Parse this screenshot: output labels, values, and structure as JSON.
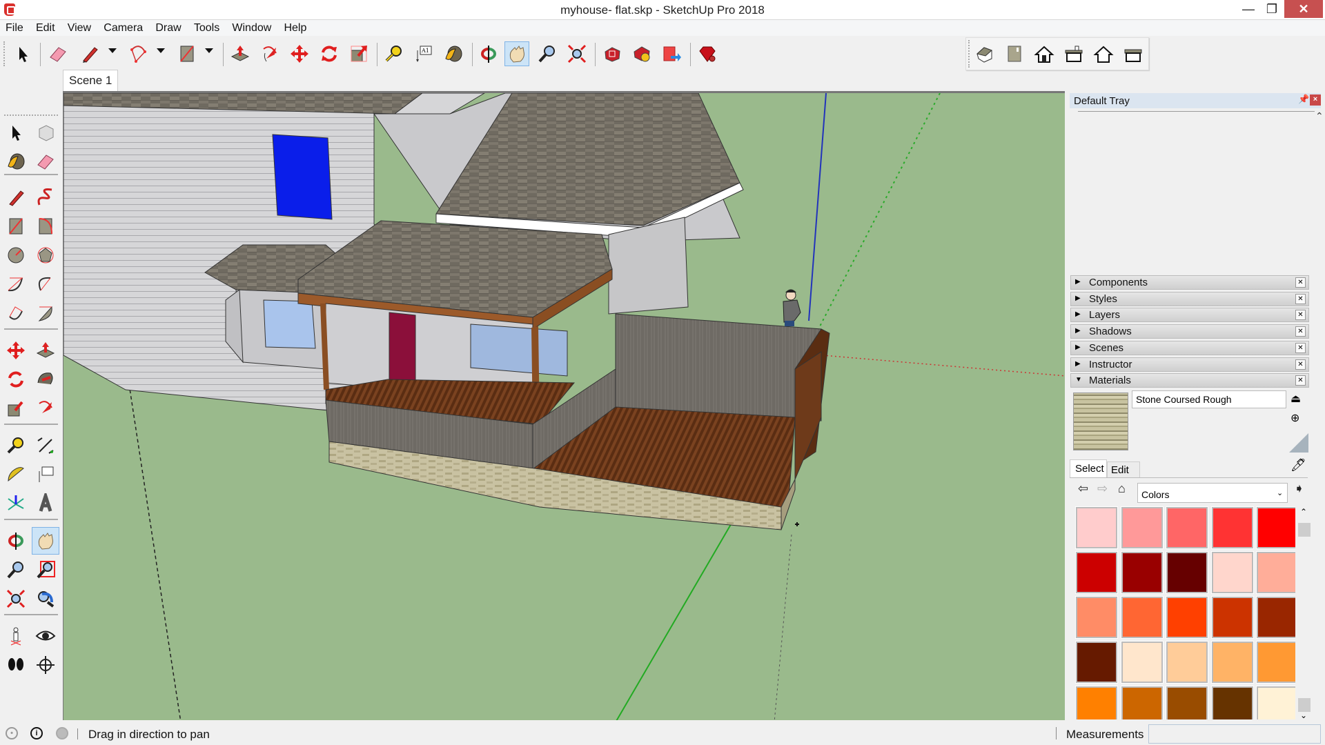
{
  "window": {
    "title": "myhouse- flat.skp - SketchUp Pro 2018",
    "controls": {
      "minimize": "—",
      "maximize": "❐",
      "close": "✕"
    }
  },
  "menu": [
    "File",
    "Edit",
    "View",
    "Camera",
    "Draw",
    "Tools",
    "Window",
    "Help"
  ],
  "toolbar": {
    "tools": [
      {
        "name": "select",
        "icon": "arrow-cursor-icon"
      },
      {
        "name": "eraser",
        "icon": "eraser-icon"
      },
      {
        "name": "line",
        "icon": "pencil-icon",
        "dropdown": true
      },
      {
        "name": "arc",
        "icon": "arc-icon",
        "dropdown": true
      },
      {
        "name": "rectangle",
        "icon": "rectangle-icon",
        "dropdown": true
      },
      {
        "name": "push-pull",
        "icon": "push-pull-icon"
      },
      {
        "name": "follow-me",
        "icon": "follow-me-icon"
      },
      {
        "name": "move",
        "icon": "move-icon"
      },
      {
        "name": "rotate",
        "icon": "rotate-icon"
      },
      {
        "name": "scale",
        "icon": "scale-icon"
      },
      {
        "name": "tape-measure",
        "icon": "tape-measure-icon"
      },
      {
        "name": "text",
        "icon": "text-label-icon"
      },
      {
        "name": "paint-bucket",
        "icon": "paint-bucket-icon"
      },
      {
        "name": "orbit",
        "icon": "orbit-icon"
      },
      {
        "name": "pan",
        "icon": "hand-icon",
        "active": true
      },
      {
        "name": "zoom",
        "icon": "magnifier-icon"
      },
      {
        "name": "zoom-extents",
        "icon": "zoom-extents-icon"
      },
      {
        "name": "3d-warehouse",
        "icon": "warehouse-icon"
      },
      {
        "name": "extension-warehouse",
        "icon": "extension-warehouse-icon"
      },
      {
        "name": "send-to-layout",
        "icon": "layout-send-icon"
      },
      {
        "name": "extension-manager",
        "icon": "ruby-gem-icon"
      }
    ],
    "views": [
      "iso-view-icon",
      "top-view-icon",
      "front-view-icon",
      "right-view-icon",
      "back-view-icon",
      "left-view-icon"
    ]
  },
  "scene_tab": "Scene 1",
  "left_toolbar": [
    [
      "select",
      "make-component"
    ],
    [
      "paint-bucket",
      "eraser"
    ],
    [
      "line",
      "freehand"
    ],
    [
      "rectangle",
      "rotated-rectangle"
    ],
    [
      "circle",
      "polygon"
    ],
    [
      "arc",
      "2-point-arc"
    ],
    [
      "3-point-arc",
      "pie"
    ],
    [
      "move",
      "push-pull"
    ],
    [
      "rotate",
      "follow-me"
    ],
    [
      "scale",
      "offset"
    ],
    [
      "tape-measure",
      "dimension"
    ],
    [
      "protractor",
      "text"
    ],
    [
      "axes",
      "3d-text"
    ],
    [
      "orbit",
      "pan"
    ],
    [
      "zoom",
      "zoom-window"
    ],
    [
      "zoom-extents",
      "previous"
    ],
    [
      "position-camera",
      "look-around"
    ],
    [
      "walk",
      "section-plane"
    ]
  ],
  "tray": {
    "title": "Default Tray",
    "panels": [
      {
        "label": "Components",
        "expanded": false
      },
      {
        "label": "Styles",
        "expanded": false
      },
      {
        "label": "Layers",
        "expanded": false
      },
      {
        "label": "Shadows",
        "expanded": false
      },
      {
        "label": "Scenes",
        "expanded": false
      },
      {
        "label": "Instructor",
        "expanded": false
      },
      {
        "label": "Materials",
        "expanded": true
      }
    ],
    "materials": {
      "current_name": "Stone Coursed Rough",
      "tabs": [
        "Select",
        "Edit"
      ],
      "active_tab": "Select",
      "library": "Colors",
      "swatches": [
        "#ffcccc",
        "#ff9999",
        "#ff6666",
        "#ff3333",
        "#ff0000",
        "#cc0000",
        "#990000",
        "#660000",
        "#ffd6cc",
        "#ffad99",
        "#ff8c66",
        "#ff6633",
        "#ff4000",
        "#cc3300",
        "#992600",
        "#661a00",
        "#ffe6cc",
        "#ffcc99",
        "#ffb366",
        "#ff9933",
        "#ff8000",
        "#cc6600",
        "#994c00",
        "#663300",
        "#fff2d6"
      ]
    }
  },
  "status": {
    "message": "Drag in direction to pan",
    "measurements_label": "Measurements",
    "measurements_value": ""
  },
  "viewport": {
    "sky_ground_color": "#9aba8c"
  }
}
